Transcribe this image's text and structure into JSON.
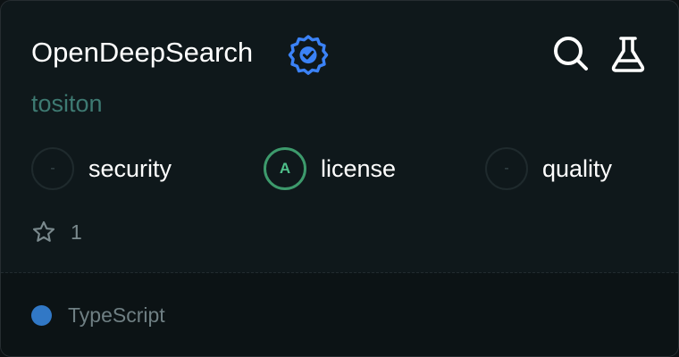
{
  "repo": {
    "name": "OpenDeepSearch",
    "owner": "tositon",
    "verified_icon": "verified-badge-icon",
    "stars": "1",
    "language": "TypeScript"
  },
  "header_actions": {
    "search_icon": "search-icon",
    "lab_icon": "flask-icon"
  },
  "metrics": [
    {
      "grade": "-",
      "label": "security"
    },
    {
      "grade": "A",
      "label": "license"
    },
    {
      "grade": "-",
      "label": "quality"
    }
  ],
  "colors": {
    "background": "#0f181b",
    "verified": "#3b82f6",
    "owner_text": "#3e7a72",
    "grade_good": "#3d9a6c",
    "language_typescript": "#3178c6"
  }
}
